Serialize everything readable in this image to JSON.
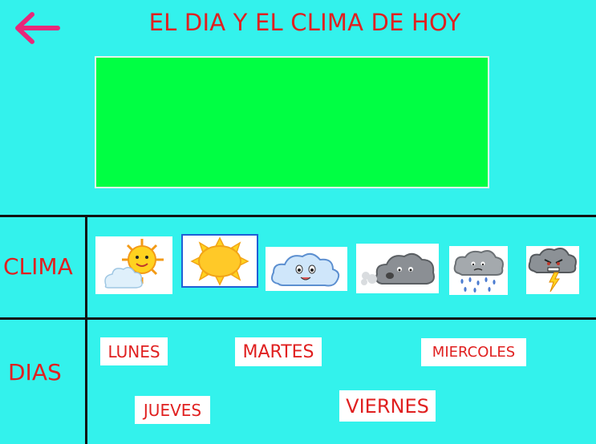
{
  "header": {
    "title": "EL DIA Y EL CLIMA DE HOY",
    "back_icon": "arrow-left-icon",
    "accent_color": "#e8287a"
  },
  "display": {
    "color": "#00ff43"
  },
  "clima": {
    "label": "CLIMA",
    "items": [
      {
        "icon": "sun-behind-cloud-icon"
      },
      {
        "icon": "sun-icon",
        "selected": true
      },
      {
        "icon": "cloud-icon"
      },
      {
        "icon": "wind-cloud-icon"
      },
      {
        "icon": "rain-cloud-icon"
      },
      {
        "icon": "storm-cloud-icon"
      }
    ]
  },
  "dias": {
    "label": "DIAS",
    "items": [
      "LUNES",
      "MARTES",
      "MIERCOLES",
      "JUEVES",
      "VIERNES"
    ]
  },
  "colors": {
    "background": "#33f2ec",
    "text": "#e02020",
    "divider": "#111111"
  }
}
